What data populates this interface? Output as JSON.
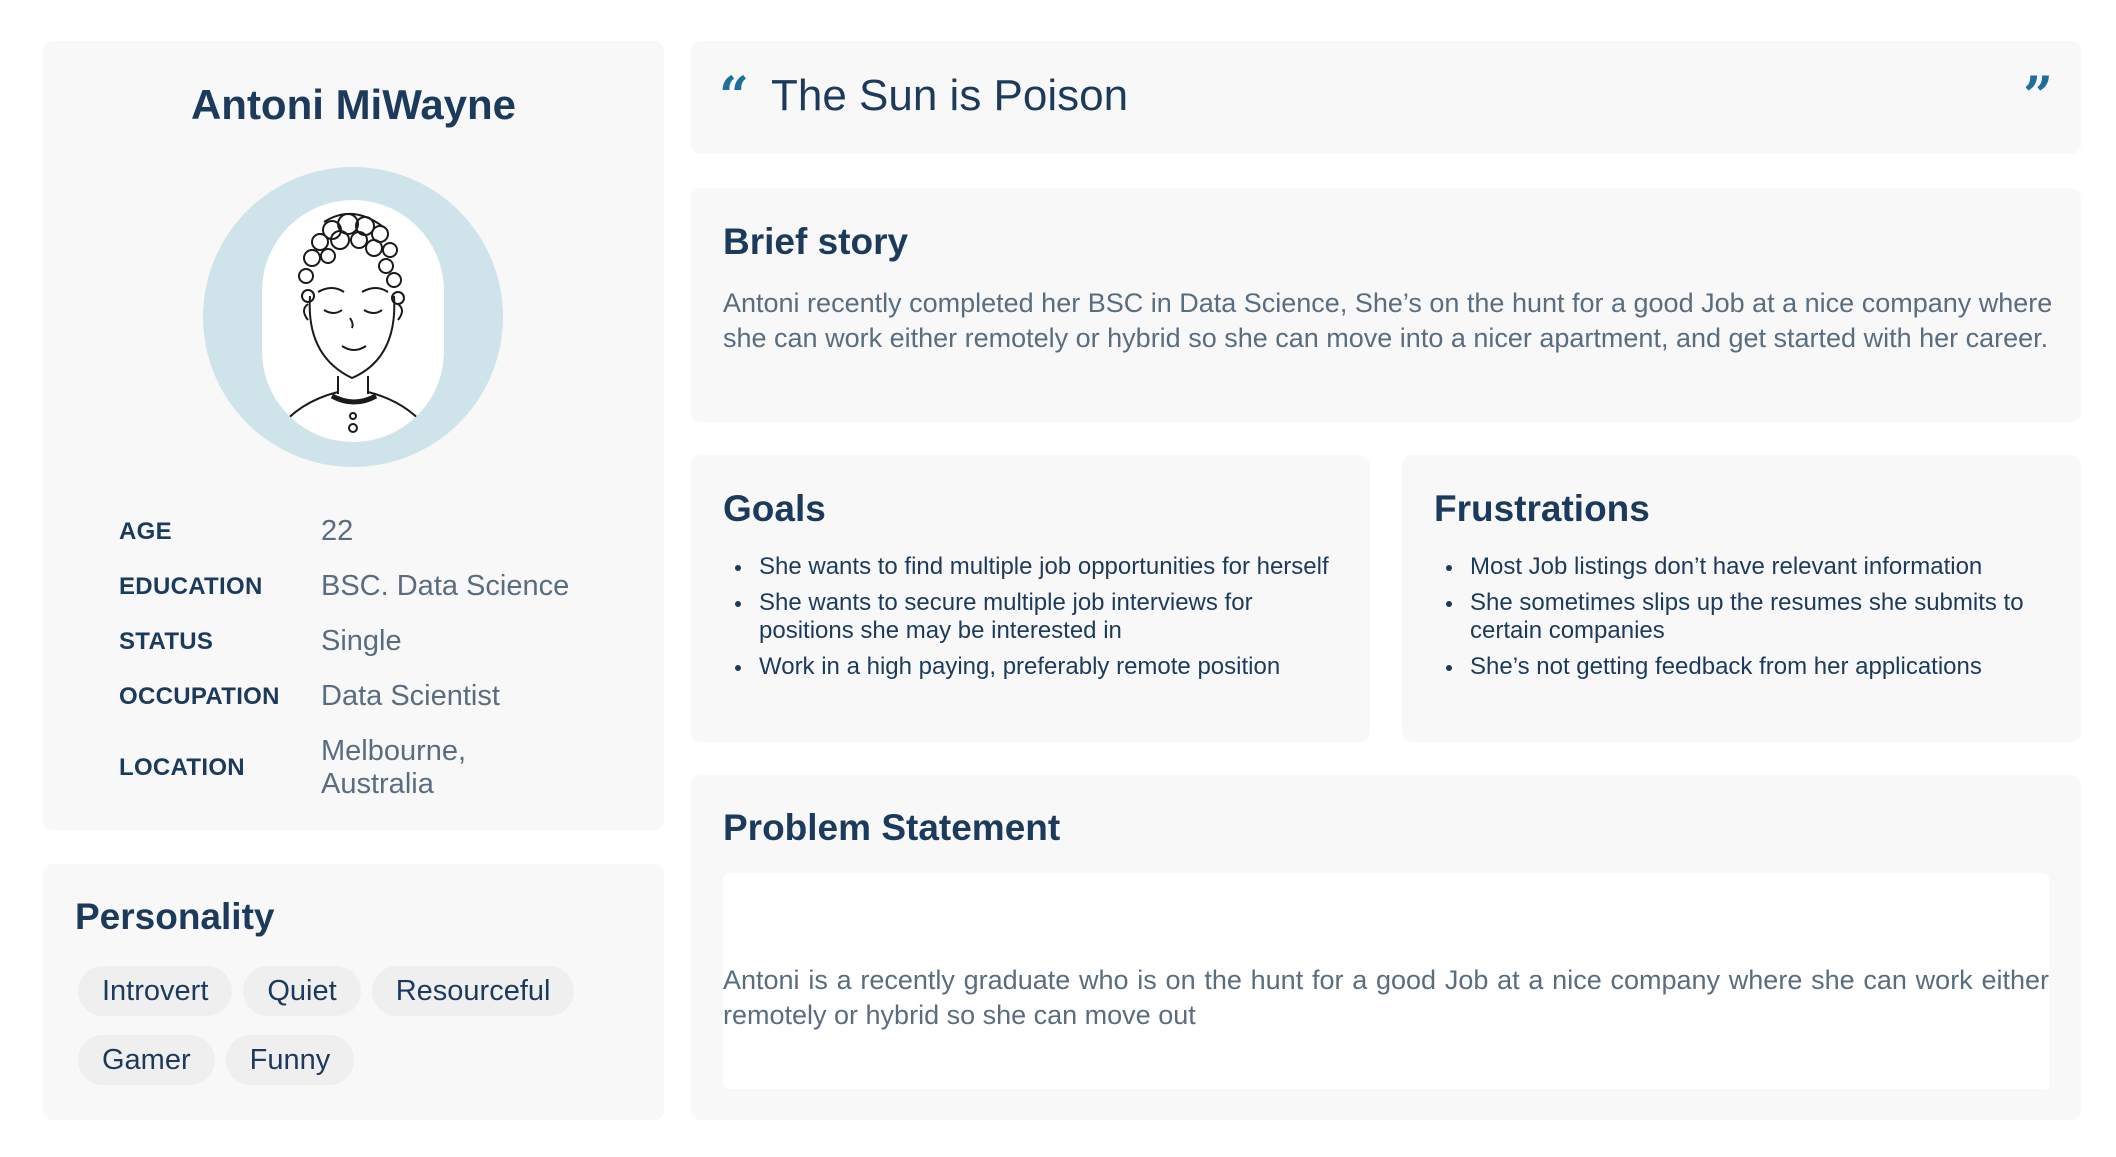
{
  "profile": {
    "name": "Antoni MiWayne",
    "facts": [
      {
        "label": "AGE",
        "value": "22"
      },
      {
        "label": "EDUCATION",
        "value": "BSC. Data Science"
      },
      {
        "label": "STATUS",
        "value": "Single"
      },
      {
        "label": "OCCUPATION",
        "value": "Data Scientist"
      },
      {
        "label": "LOCATION",
        "value": "Melbourne, Australia"
      }
    ],
    "avatar_icon": "avatar-illustration-icon",
    "ring_color": "#cfe3ea"
  },
  "personality": {
    "title": "Personality",
    "tags": [
      "Introvert",
      "Quiet",
      "Resourceful",
      "Gamer",
      "Funny"
    ]
  },
  "quote": {
    "open_mark": "“",
    "text": "The Sun is Poison",
    "close_mark": "”",
    "accent_color": "#1f6f9c"
  },
  "story": {
    "title": "Brief story",
    "text": "Antoni recently completed her BSC in Data Science, She’s on the hunt for a good Job at a nice company where she can work either remotely or hybrid so she can move into a nicer apartment, and get started with her career."
  },
  "goals": {
    "title": "Goals",
    "items": [
      "She wants to find multiple job opportunities for herself",
      "She wants to secure multiple job interviews for positions she may be interested in",
      "Work in a high paying, preferably remote position"
    ]
  },
  "frustrations": {
    "title": "Frustrations",
    "items": [
      "Most Job listings don’t have relevant information",
      "She sometimes slips up the resumes she submits to certain companies",
      "She’s not getting feedback from her applications"
    ]
  },
  "problem": {
    "title": "Problem Statement",
    "text": "Antoni is a recently graduate who is on the hunt for a good Job at a nice company where she can work either remotely or hybrid so she can move out"
  }
}
